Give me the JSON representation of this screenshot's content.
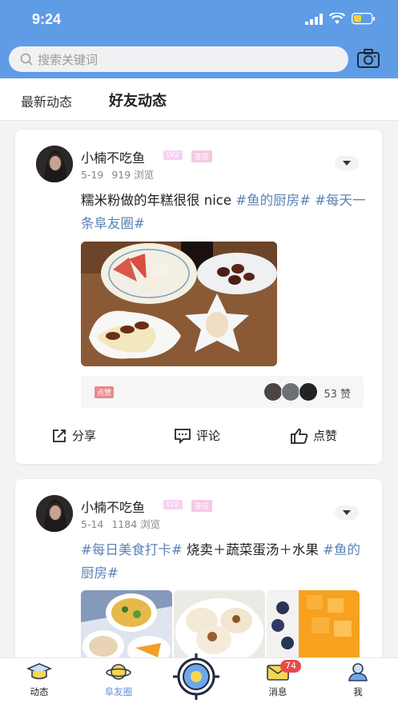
{
  "status": {
    "time": "9:24"
  },
  "search": {
    "placeholder": "搜索关键词"
  },
  "tabs": [
    {
      "label": "最新动态"
    },
    {
      "label": "好友动态"
    }
  ],
  "posts": [
    {
      "user": "小楠不吃鱼",
      "level": "LV2",
      "badge": "答应",
      "date": "5-19",
      "views": "919 浏览",
      "text": "糯米粉做的年糕很很 nice ",
      "hashtag1": "#鱼的厨房#",
      "hashtag2": "#每天一条阜友圈#",
      "like_label": "点赞",
      "like_count": "53 赞"
    },
    {
      "user": "小楠不吃鱼",
      "level": "LV2",
      "badge": "答应",
      "date": "5-14",
      "views": "1184 浏览",
      "hashtag1": "#每日美食打卡#",
      "text": " 烧卖＋蔬菜蛋汤＋水果",
      "hashtag2": "#鱼的厨房#"
    }
  ],
  "actions": {
    "share": "分享",
    "comment": "评论",
    "like": "点赞"
  },
  "tabbar": {
    "items": [
      {
        "label": "动态",
        "icon": "graduation-cap-icon"
      },
      {
        "label": "阜友圈",
        "icon": "planet-icon"
      },
      {
        "label": "消息",
        "icon": "mail-icon"
      },
      {
        "label": "我",
        "icon": "person-icon"
      }
    ],
    "message_count": "74"
  },
  "colors": {
    "header": "#5f9ce6",
    "hashtag": "#5b81b6",
    "badge": "#e94a48",
    "active_tab": "#5a8ee0"
  }
}
